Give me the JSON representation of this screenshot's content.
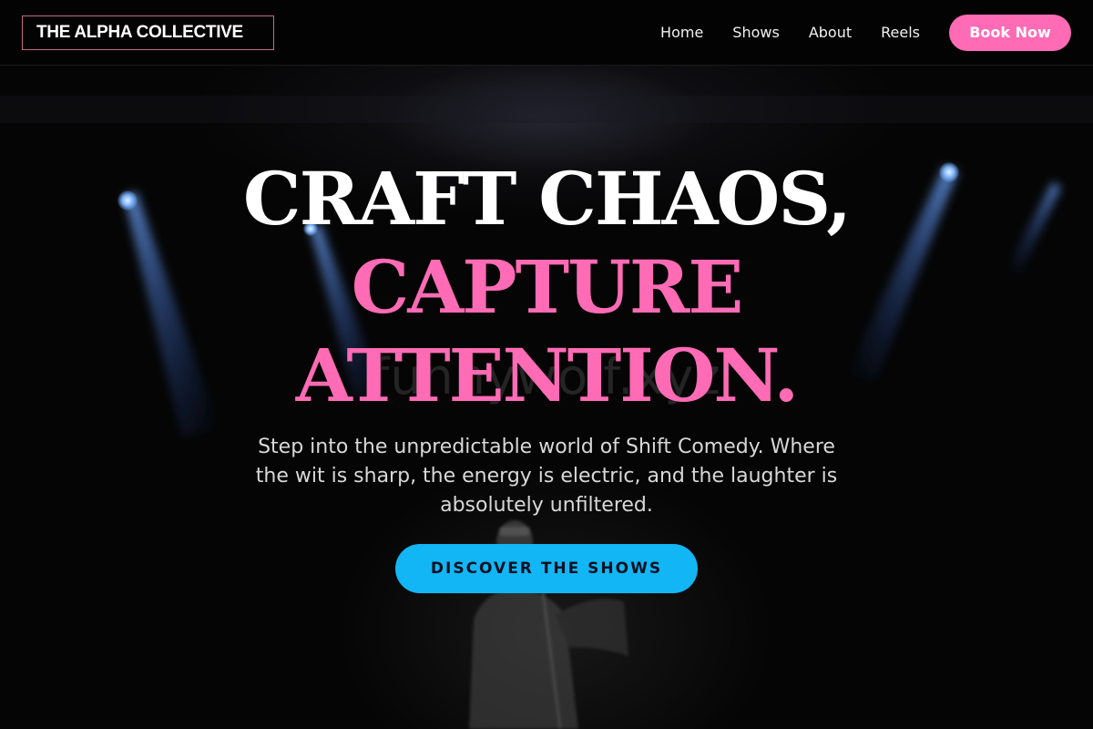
{
  "header": {
    "logo_text": "THE ALPHA COLLECTIVE",
    "nav": [
      {
        "label": "Home"
      },
      {
        "label": "Shows"
      },
      {
        "label": "About"
      },
      {
        "label": "Reels"
      }
    ],
    "book_button": "Book Now"
  },
  "hero": {
    "headline_line_1": "CRAFT CHAOS,",
    "headline_line_2": "CAPTURE",
    "headline_line_3": "ATTENTION.",
    "subtitle": "Step into the unpredictable world of Shift Comedy. Where the wit is sharp, the energy is electric, and the laughter is absolutely unfiltered.",
    "cta_label": "DISCOVER THE SHOWS",
    "watermark": "funnywolf.xyz"
  },
  "colors": {
    "accent_pink": "#ff6bb5",
    "accent_blue": "#12b6f5",
    "background": "#050505"
  },
  "icons": [
    "stage-spotlight",
    "performer-silhouette"
  ]
}
